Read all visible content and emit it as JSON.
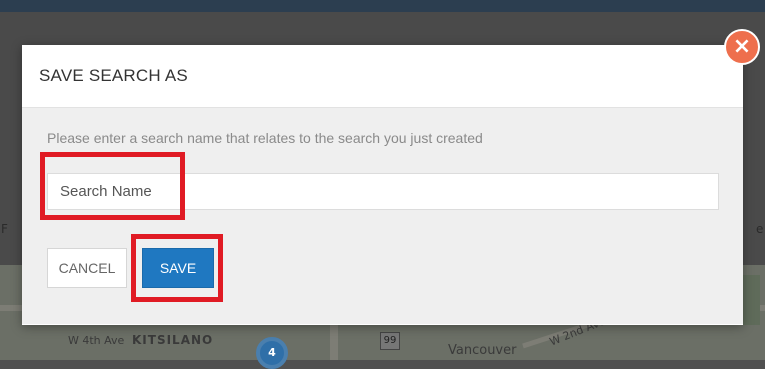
{
  "modal": {
    "title": "SAVE SEARCH AS",
    "hint": "Please enter a search name that relates to the search you just created",
    "input_placeholder": "Search Name",
    "cancel_label": "CANCEL",
    "save_label": "SAVE",
    "close_icon": "×"
  },
  "background_map": {
    "labels": [
      "W 4th Ave",
      "KITSILANO",
      "Vancouver",
      "W 2nd Ave"
    ],
    "cluster_count": "4",
    "route_number": "99",
    "edge_left": "F",
    "edge_right": "e"
  },
  "colors": {
    "save_button": "#1f78c1",
    "close_button": "#ee6f4d",
    "annotation": "#e01b24"
  }
}
